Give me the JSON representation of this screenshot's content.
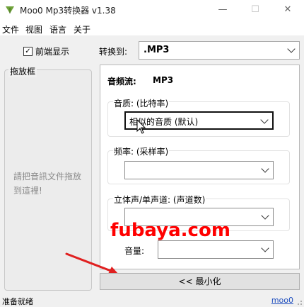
{
  "window": {
    "title": "Moo0 Mp3转换器 v1.38",
    "minimize_glyph": "—",
    "maximize_glyph": "☐",
    "close_glyph": "✕"
  },
  "menu": [
    "文件",
    "视图",
    "语言",
    "关于"
  ],
  "left": {
    "checkbox_label": "前端显示",
    "checkbox_checked": true,
    "drop_label": "拖放框",
    "drop_hint": "請把音訊文件拖放到這裡!"
  },
  "convert": {
    "label": "转换到:",
    "value": ".MP3"
  },
  "panel": {
    "stream_label": "音频流:",
    "stream_value": "MP3",
    "quality": {
      "label": "音质:  (比特率)",
      "value": "相似的音质 (默认)"
    },
    "frequency": {
      "label": "频率:  (采样率)",
      "value": ""
    },
    "channels": {
      "label": "立体声/单声道:  (声道数)",
      "value": ""
    },
    "volume": {
      "label": "音量:",
      "value": ""
    }
  },
  "minimize_button": "<< 最小化",
  "watermark": "fubaya.com",
  "status": {
    "left": "准备就绪",
    "right": "moo0"
  },
  "colors": {
    "watermark": "#ff0000",
    "arrow": "#e02020",
    "link": "#1f4fbf"
  },
  "icons": {
    "app": "leaf-icon",
    "checkbox": "check-icon",
    "dropdown": "chevron-down-icon",
    "annotation": "red-arrow"
  }
}
